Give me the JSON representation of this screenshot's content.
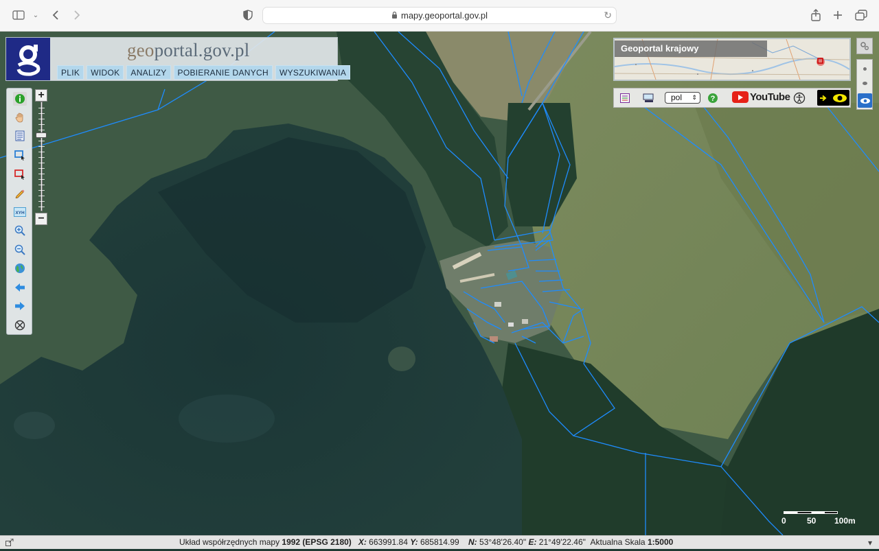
{
  "browser": {
    "url": "mapy.geoportal.gov.pl"
  },
  "logo": {
    "text_part1": "geo",
    "text_part2": "portal.gov.pl"
  },
  "menu": [
    {
      "label": "PLIK"
    },
    {
      "label": "WIDOK"
    },
    {
      "label": "ANALIZY"
    },
    {
      "label": "POBIERANIE DANYCH"
    },
    {
      "label": "WYSZUKIWANIA"
    }
  ],
  "toolbar": {
    "tools": [
      {
        "icon": "info-icon"
      },
      {
        "icon": "pan-hand-icon"
      },
      {
        "icon": "legend-icon"
      },
      {
        "icon": "select-area-icon"
      },
      {
        "icon": "select-object-icon"
      },
      {
        "icon": "draw-pencil-icon"
      },
      {
        "icon": "xyh-coordinates-icon",
        "label": "XYH"
      },
      {
        "icon": "zoom-in-icon"
      },
      {
        "icon": "zoom-out-icon"
      },
      {
        "icon": "full-extent-globe-icon"
      },
      {
        "icon": "previous-view-arrow-icon"
      },
      {
        "icon": "next-view-arrow-icon"
      },
      {
        "icon": "close-circle-icon"
      }
    ]
  },
  "zoom": {
    "plus": "+",
    "minus": "−"
  },
  "overview": {
    "title": "Geoportal krajowy"
  },
  "iconbar": {
    "language": "pol",
    "youtube_label": "YouTube"
  },
  "scale": {
    "labels": [
      "0",
      "50",
      "100m"
    ]
  },
  "status": {
    "coord_system_prefix": "Układ współrzędnych mapy",
    "coord_system": "1992 (EPSG 2180)",
    "x_label": "X:",
    "x_value": "663991.84",
    "y_label": "Y:",
    "y_value": "685814.99",
    "n_label": "N:",
    "n_value": "53°48'26.40\"",
    "e_label": "E:",
    "e_value": "21°49'22.46\"",
    "scale_prefix": "Aktualna Skala",
    "scale_value": "1:5000"
  },
  "colors": {
    "logo_blue": "#1f2a86",
    "menu_bg": "#b3d7ec",
    "parcel_line": "#1e8cff",
    "lake": "#1d3a3a"
  }
}
